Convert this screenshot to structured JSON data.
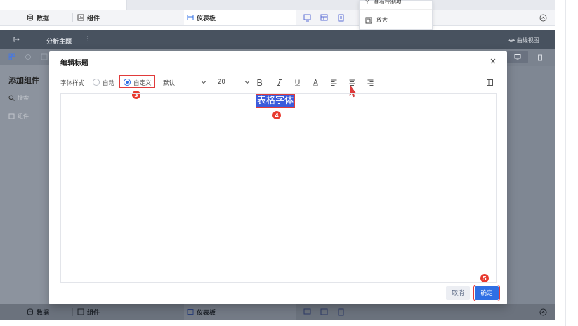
{
  "top_bar": {
    "tabs": [
      {
        "label": "数据",
        "icon": "database-icon"
      },
      {
        "label": "组件",
        "icon": "component-icon"
      },
      {
        "label": "仪表板",
        "icon": "dashboard-icon"
      }
    ],
    "context_menu": {
      "partial_item": "查看控制项",
      "zoom_label": "放大"
    }
  },
  "toolbar": {
    "analysis_topic": "分析主题",
    "curve_view": "曲线视图"
  },
  "left_panel": {
    "title": "添加组件",
    "search_placeholder": "搜索",
    "component_label": "组件"
  },
  "dialog": {
    "title": "编辑标题",
    "font_style_label": "字体样式",
    "auto_label": "自动",
    "custom_label": "自定义",
    "font_family": "默认",
    "font_size": "20",
    "title_text": "表格字体",
    "cancel_label": "取消",
    "confirm_label": "确定",
    "selected_option": "custom"
  },
  "annotations": {
    "step3": "3",
    "step4": "4",
    "step5": "5",
    "highlight_color": "#e03b3b"
  },
  "bottom_bar": {
    "tabs": [
      {
        "label": "数据",
        "icon": "database-icon"
      },
      {
        "label": "组件",
        "icon": "component-icon"
      },
      {
        "label": "仪表板",
        "icon": "dashboard-icon"
      }
    ]
  }
}
